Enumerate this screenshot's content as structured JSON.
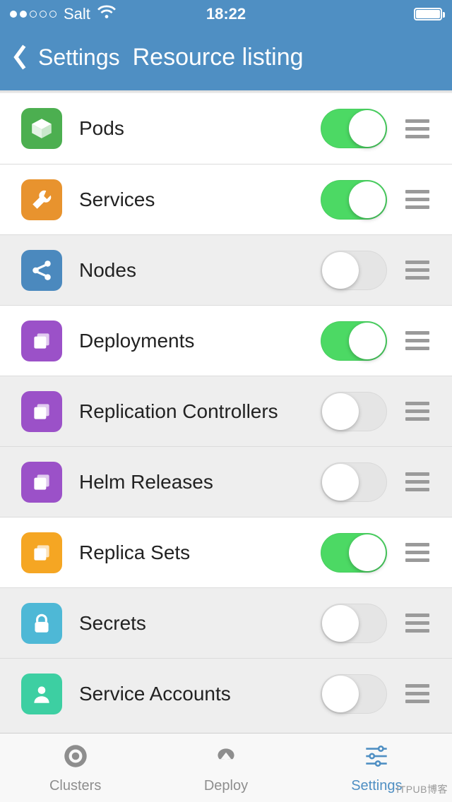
{
  "status": {
    "carrier": "Salt",
    "time": "18:22"
  },
  "nav": {
    "back_label": "Settings",
    "title": "Resource listing"
  },
  "rows": [
    {
      "label": "Pods",
      "icon": "cube",
      "color": "c-green",
      "on": true
    },
    {
      "label": "Services",
      "icon": "wrench",
      "color": "c-darkorange",
      "on": true
    },
    {
      "label": "Nodes",
      "icon": "share",
      "color": "c-blue",
      "on": false
    },
    {
      "label": "Deployments",
      "icon": "stack",
      "color": "c-purple",
      "on": true
    },
    {
      "label": "Replication Controllers",
      "icon": "stack",
      "color": "c-purple",
      "on": false
    },
    {
      "label": "Helm Releases",
      "icon": "stack",
      "color": "c-purple",
      "on": false
    },
    {
      "label": "Replica Sets",
      "icon": "stack",
      "color": "c-orange",
      "on": true
    },
    {
      "label": "Secrets",
      "icon": "lock",
      "color": "c-lblue",
      "on": false
    },
    {
      "label": "Service Accounts",
      "icon": "person",
      "color": "c-teal",
      "on": false
    }
  ],
  "tabs": {
    "clusters": "Clusters",
    "deploy": "Deploy",
    "settings": "Settings"
  },
  "watermark": "ITPUB博客"
}
